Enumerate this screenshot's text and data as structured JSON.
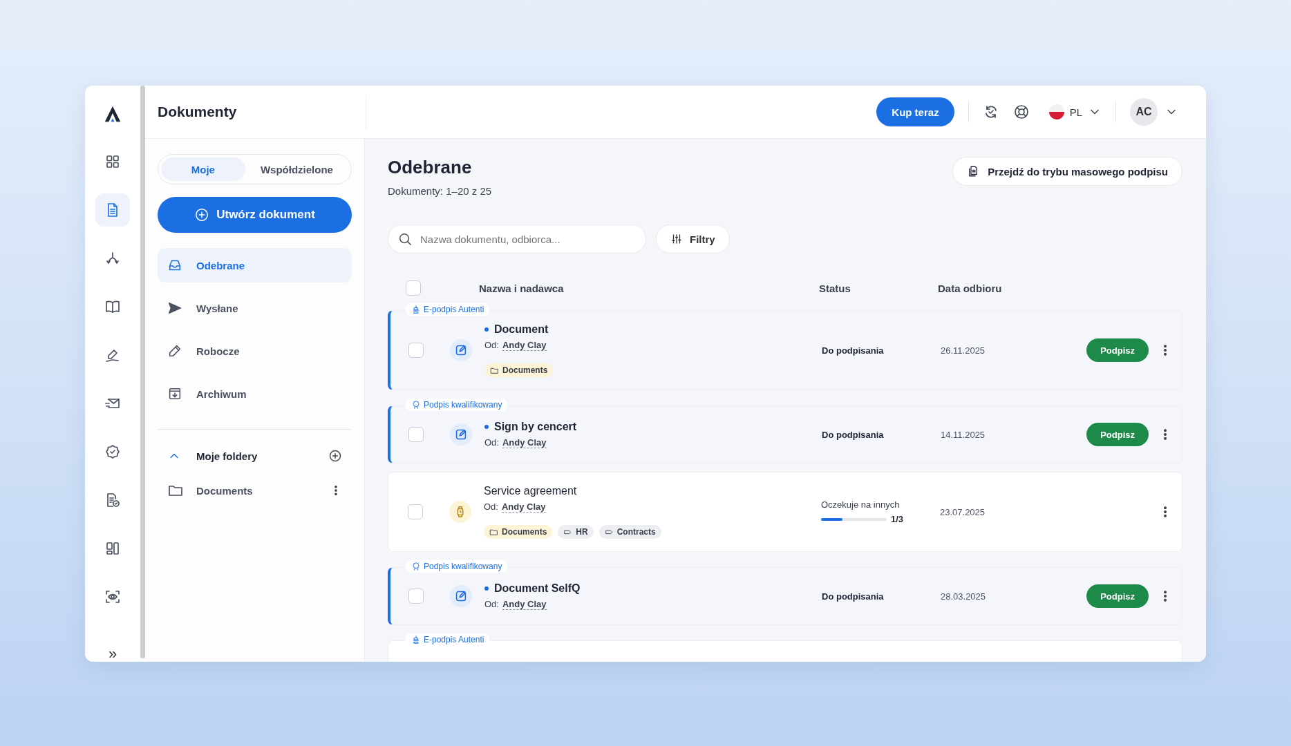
{
  "app": {
    "title": "Dokumenty"
  },
  "rail": [
    {
      "selected": false
    },
    {
      "selected": true
    },
    {
      "selected": false
    },
    {
      "selected": false
    },
    {
      "selected": false
    },
    {
      "selected": false
    },
    {
      "selected": false
    },
    {
      "selected": false
    },
    {
      "selected": false
    },
    {
      "selected": false
    }
  ],
  "rail_expand": "»",
  "header": {
    "buy_button": "Kup teraz",
    "language": "PL",
    "avatar": "AC"
  },
  "tabs": [
    {
      "label": "Moje",
      "selected": true
    },
    {
      "label": "Współdzielone",
      "selected": false
    }
  ],
  "create_button": "Utwórz dokument",
  "nav": [
    {
      "label": "Odebrane",
      "selected": true
    },
    {
      "label": "Wysłane",
      "selected": false
    },
    {
      "label": "Robocze",
      "selected": false
    },
    {
      "label": "Archiwum",
      "selected": false
    }
  ],
  "folders": {
    "title": "Moje foldery",
    "expanded": true,
    "items": [
      {
        "label": "Documents"
      }
    ]
  },
  "main": {
    "title": "Odebrane",
    "subtitle": "Dokumenty: 1–20 z 25",
    "bulk_button": "Przejdź do trybu masowego podpisu",
    "search": {
      "placeholder": "Nazwa dokumentu, odbiorca..."
    },
    "filter_button": "Filtry",
    "table": {
      "select_all": {
        "checked": false
      },
      "columns": [
        "Nazwa i nadawca",
        "Status",
        "Data odbioru"
      ],
      "rows": [
        {
          "signature": {
            "kind": "autenti",
            "label": "E-podpis Autenti"
          },
          "checked": false,
          "unread": true,
          "kind": "sign",
          "name": "Document",
          "sender_label": "Od:",
          "sender": "Andy Clay",
          "tags": [
            {
              "kind": "folder",
              "label": "Documents"
            }
          ],
          "status": {
            "kind": "text",
            "label": "Do podpisania"
          },
          "date": "26.11.2025",
          "action": "Podpisz"
        },
        {
          "signature": {
            "kind": "qualified",
            "label": "Podpis kwalifikowany"
          },
          "checked": false,
          "unread": true,
          "kind": "sign",
          "name": "Sign by cencert",
          "sender_label": "Od:",
          "sender": "Andy Clay",
          "tags": [],
          "status": {
            "kind": "text",
            "label": "Do podpisania"
          },
          "date": "14.11.2025",
          "action": "Podpisz"
        },
        {
          "checked": false,
          "unread": false,
          "kind": "waiting",
          "name": "Service agreement",
          "sender_label": "Od:",
          "sender": "Andy Clay",
          "tags": [
            {
              "kind": "folder",
              "label": "Documents"
            },
            {
              "kind": "label",
              "label": "HR"
            },
            {
              "kind": "label",
              "label": "Contracts"
            }
          ],
          "status": {
            "kind": "progress",
            "label": "Oczekuje na innych",
            "level": 0.33,
            "count": "1/3"
          },
          "date": "23.07.2025"
        },
        {
          "signature": {
            "kind": "qualified",
            "label": "Podpis kwalifikowany"
          },
          "checked": false,
          "unread": true,
          "kind": "sign",
          "name": "Document SelfQ",
          "sender_label": "Od:",
          "sender": "Andy Clay",
          "tags": [],
          "status": {
            "kind": "text",
            "label": "Do podpisania"
          },
          "date": "28.03.2025",
          "action": "Podpisz"
        },
        {
          "signature": {
            "kind": "autenti",
            "label": "E-podpis Autenti"
          }
        }
      ]
    }
  }
}
